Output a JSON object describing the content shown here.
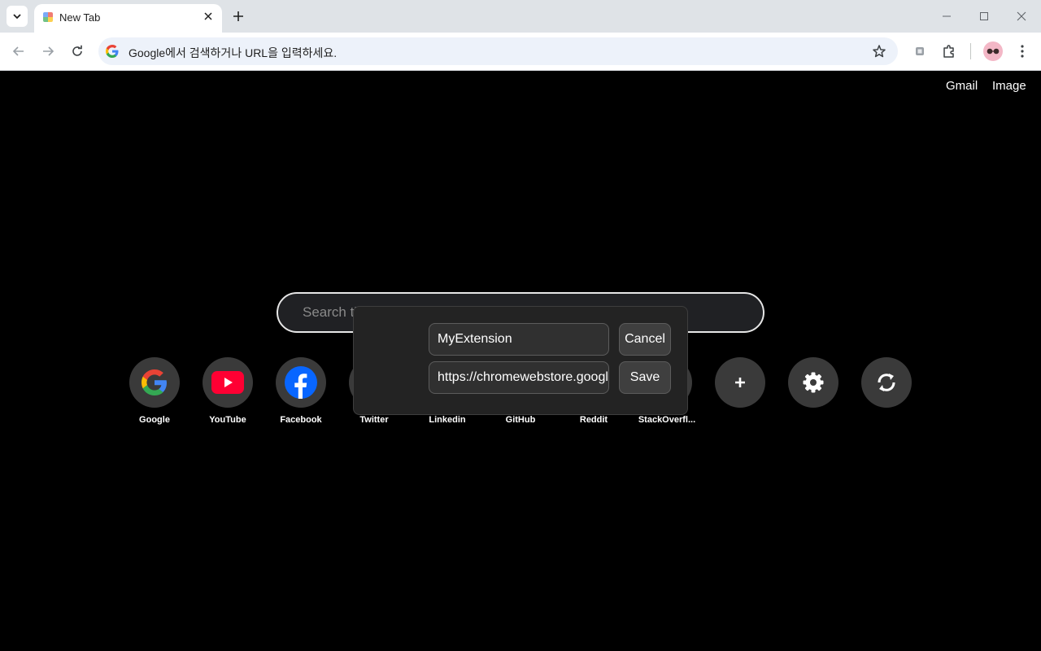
{
  "browser": {
    "tab_title": "New Tab",
    "address_placeholder": "Google에서 검색하거나 URL을 입력하세요."
  },
  "page": {
    "top_links": [
      "Gmail",
      "Image"
    ],
    "search_placeholder": "Search th",
    "shortcuts": [
      {
        "label": "Google",
        "icon": "google-icon"
      },
      {
        "label": "YouTube",
        "icon": "youtube-icon"
      },
      {
        "label": "Facebook",
        "icon": "facebook-icon"
      },
      {
        "label": "Twitter",
        "icon": "twitter-icon"
      },
      {
        "label": "Linkedin",
        "icon": "linkedin-icon"
      },
      {
        "label": "GitHub",
        "icon": "github-icon"
      },
      {
        "label": "Reddit",
        "icon": "reddit-icon"
      },
      {
        "label": "StackOverfl...",
        "icon": "stackoverflow-icon"
      },
      {
        "label": "",
        "icon": "plus-icon"
      },
      {
        "label": "",
        "icon": "gear-icon"
      },
      {
        "label": "",
        "icon": "sync-icon"
      }
    ]
  },
  "dialog": {
    "name_value": "MyExtension",
    "url_value": "https://chromewebstore.google.com",
    "cancel_label": "Cancel",
    "save_label": "Save"
  },
  "colors": {
    "page_bg": "#000000",
    "youtube_red": "#ff0033",
    "facebook_blue": "#0866ff"
  }
}
